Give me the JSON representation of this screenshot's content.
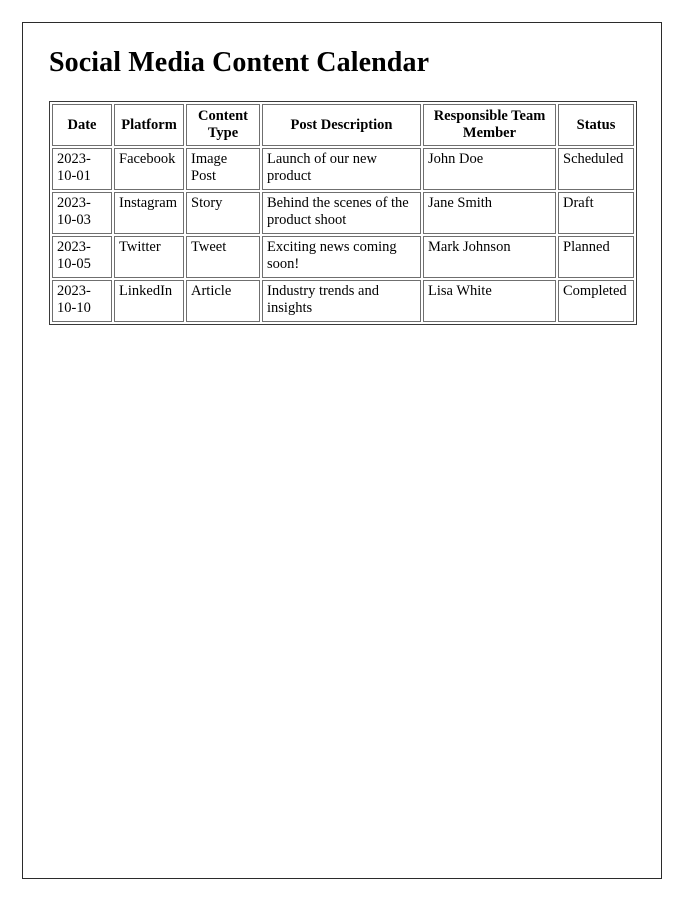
{
  "document": {
    "title": "Social Media Content Calendar",
    "frame_border_color": "#2b2b2b",
    "table_border_color": "#6f6f6f",
    "text_color": "#000000",
    "background_color": "#ffffff"
  },
  "table": {
    "columns": [
      {
        "key": "date",
        "label": "Date"
      },
      {
        "key": "platform",
        "label": "Platform"
      },
      {
        "key": "type",
        "label": "Content Type"
      },
      {
        "key": "desc",
        "label": "Post Description"
      },
      {
        "key": "member",
        "label": "Responsible Team Member"
      },
      {
        "key": "status",
        "label": "Status"
      }
    ],
    "rows": [
      {
        "date": "2023-10-01",
        "platform": "Facebook",
        "type": "Image Post",
        "desc": "Launch of our new product",
        "member": "John Doe",
        "status": "Scheduled"
      },
      {
        "date": "2023-10-03",
        "platform": "Instagram",
        "type": "Story",
        "desc": "Behind the scenes of the product shoot",
        "member": "Jane Smith",
        "status": "Draft"
      },
      {
        "date": "2023-10-05",
        "platform": "Twitter",
        "type": "Tweet",
        "desc": "Exciting news coming soon!",
        "member": "Mark Johnson",
        "status": "Planned"
      },
      {
        "date": "2023-10-10",
        "platform": "LinkedIn",
        "type": "Article",
        "desc": "Industry trends and insights",
        "member": "Lisa White",
        "status": "Completed"
      }
    ]
  }
}
